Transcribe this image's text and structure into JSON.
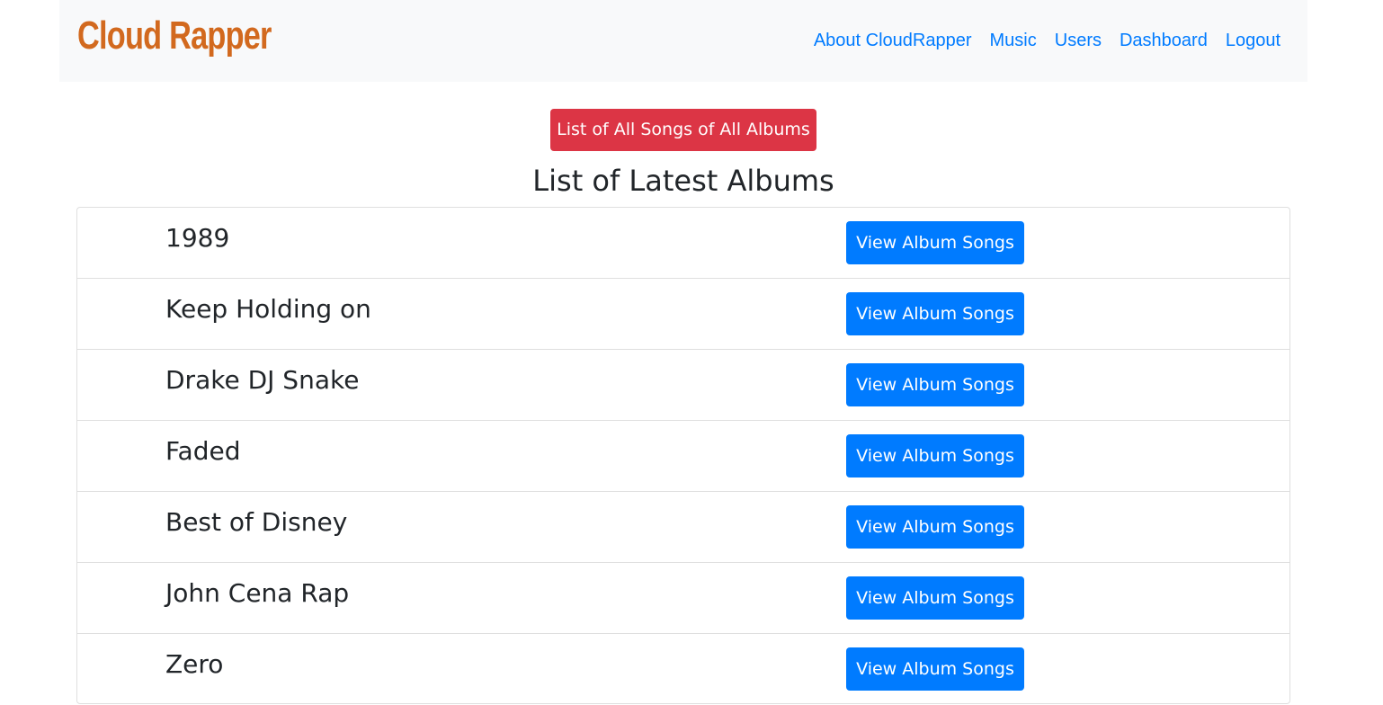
{
  "navbar": {
    "brand": "Cloud Rapper",
    "links": [
      "About CloudRapper",
      "Music",
      "Users",
      "Dashboard",
      "Logout"
    ]
  },
  "main": {
    "all_songs_button": "List of All Songs of All Albums",
    "heading": "List of Latest Albums",
    "albums": [
      {
        "name": "1989",
        "button": "View Album Songs"
      },
      {
        "name": "Keep Holding on",
        "button": "View Album Songs"
      },
      {
        "name": "Drake DJ Snake",
        "button": "View Album Songs"
      },
      {
        "name": "Faded",
        "button": "View Album Songs"
      },
      {
        "name": "Best of Disney",
        "button": "View Album Songs"
      },
      {
        "name": "John Cena Rap",
        "button": "View Album Songs"
      },
      {
        "name": "Zero",
        "button": "View Album Songs"
      }
    ]
  },
  "colors": {
    "brand": "#d2691e",
    "link": "#007bff",
    "danger": "#dc3545",
    "primary": "#007bff",
    "navbar_bg": "#f8f9fa"
  }
}
